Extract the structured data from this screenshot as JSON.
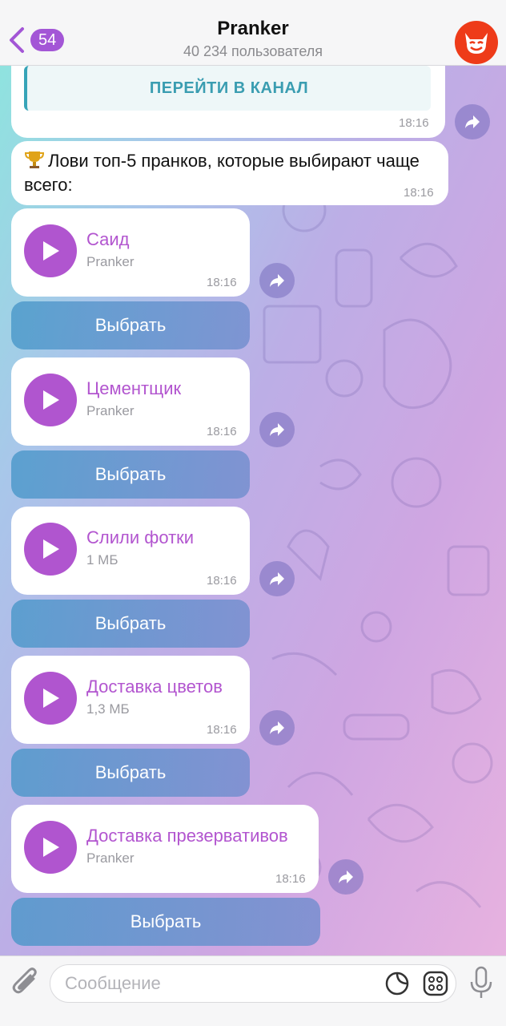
{
  "header": {
    "back_count": "54",
    "title": "Pranker",
    "subtitle": "40 234 пользователя"
  },
  "post": {
    "button_label": "ПЕРЕЙТИ В КАНАЛ",
    "time": "18:16"
  },
  "text_message": {
    "icon": "trophy-icon",
    "text": "Лови топ-5 пранков, которые выбирают чаще всего:",
    "time": "18:16"
  },
  "audio_messages": [
    {
      "title": "Саид",
      "subtitle": "Pranker",
      "time": "18:16",
      "button": "Выбрать"
    },
    {
      "title": "Цементщик",
      "subtitle": "Pranker",
      "time": "18:16",
      "button": "Выбрать"
    },
    {
      "title": "Слили фотки",
      "subtitle": "1 МБ",
      "time": "18:16",
      "button": "Выбрать"
    },
    {
      "title": "Доставка цветов",
      "subtitle": "1,3 МБ",
      "time": "18:16",
      "button": "Выбрать"
    },
    {
      "title": "Доставка презервативов",
      "subtitle": "Pranker",
      "time": "18:16",
      "button": "Выбрать"
    }
  ],
  "input": {
    "placeholder": "Сообщение"
  },
  "colors": {
    "accent": "#a356d6",
    "audio_title": "#b255cf",
    "channel_button": "#3a9db1",
    "avatar": "#ee3b19"
  }
}
